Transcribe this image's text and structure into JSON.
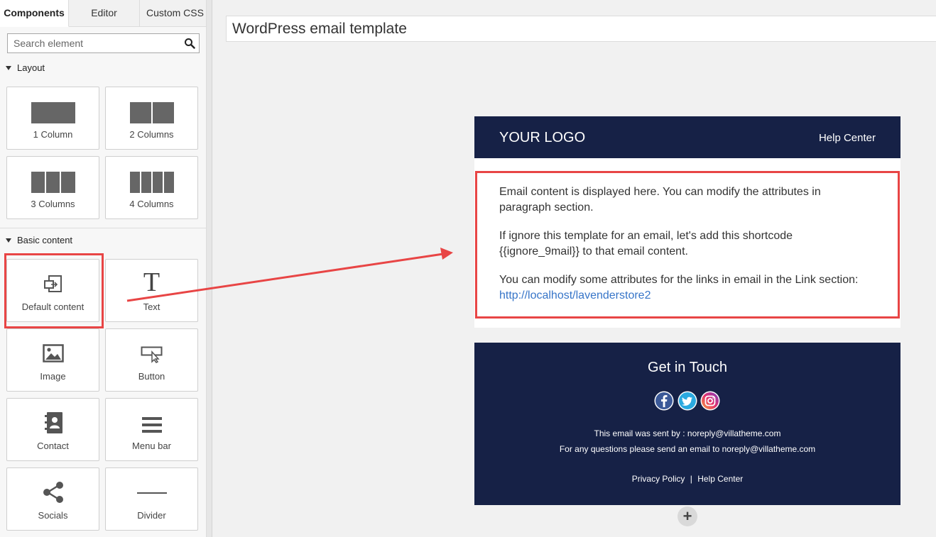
{
  "sidebar": {
    "tabs": [
      {
        "label": "Components",
        "active": true
      },
      {
        "label": "Editor",
        "active": false
      },
      {
        "label": "Custom CSS",
        "active": false
      }
    ],
    "search": {
      "placeholder": "Search element",
      "icon": "search-icon"
    },
    "layout": {
      "title": "Layout",
      "items": [
        {
          "label": "1 Column",
          "icon": "one-column-icon"
        },
        {
          "label": "2 Columns",
          "icon": "two-columns-icon"
        },
        {
          "label": "3 Columns",
          "icon": "three-columns-icon"
        },
        {
          "label": "4 Columns",
          "icon": "four-columns-icon"
        }
      ]
    },
    "basic": {
      "title": "Basic content",
      "items": [
        {
          "label": "Default content",
          "icon": "default-content-icon"
        },
        {
          "label": "Text",
          "icon": "text-icon"
        },
        {
          "label": "Image",
          "icon": "image-icon"
        },
        {
          "label": "Button",
          "icon": "button-icon"
        },
        {
          "label": "Contact",
          "icon": "contact-icon"
        },
        {
          "label": "Menu bar",
          "icon": "menu-bar-icon"
        },
        {
          "label": "Socials",
          "icon": "share-icon"
        },
        {
          "label": "Divider",
          "icon": "divider-icon"
        }
      ]
    }
  },
  "canvas": {
    "subject": "WordPress email template",
    "add_label": "+"
  },
  "email": {
    "header": {
      "logo": "YOUR LOGO",
      "help": "Help Center"
    },
    "body": {
      "p1": "Email content is displayed here. You can modify the attributes in paragraph section.",
      "p2": "If ignore this template for an email, let's add this shortcode {{ignore_9mail}} to that email content.",
      "p3": "You can modify some attributes for the links in email in the Link section:",
      "link": "http://localhost/lavenderstore2"
    },
    "footer": {
      "title": "Get in Touch",
      "socials": [
        "facebook-icon",
        "twitter-icon",
        "instagram-icon"
      ],
      "line1": "This email was sent by : noreply@villatheme.com",
      "line2": "For any questions please send an email to noreply@villatheme.com",
      "policy": "Privacy Policy",
      "separator": "|",
      "help": "Help Center"
    }
  },
  "colors": {
    "header_bg": "#162146",
    "accent_red": "#e84545",
    "link": "#3775c8"
  }
}
